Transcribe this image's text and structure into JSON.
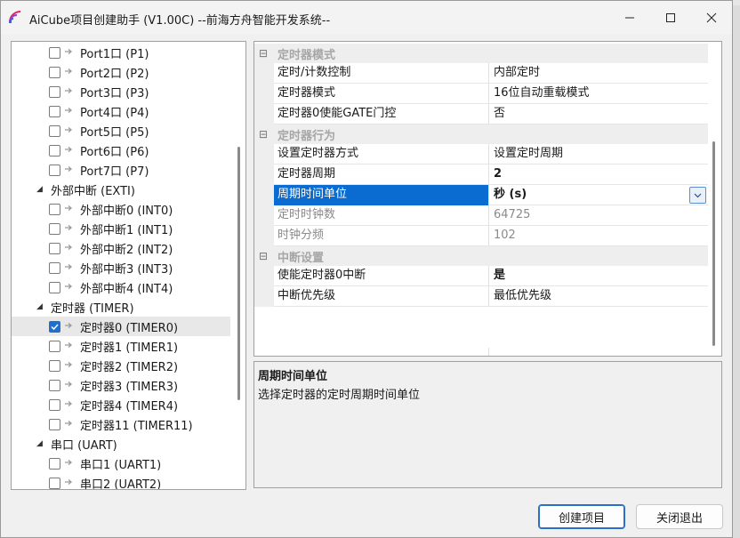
{
  "window": {
    "title": "AiCube项目创建助手 (V1.00C) --前海方舟智能开发系统--"
  },
  "tree": [
    {
      "label": "Port1口 (P1)",
      "level": 2,
      "checkbox": true,
      "checked": false
    },
    {
      "label": "Port2口 (P2)",
      "level": 2,
      "checkbox": true,
      "checked": false
    },
    {
      "label": "Port3口 (P3)",
      "level": 2,
      "checkbox": true,
      "checked": false
    },
    {
      "label": "Port4口 (P4)",
      "level": 2,
      "checkbox": true,
      "checked": false
    },
    {
      "label": "Port5口 (P5)",
      "level": 2,
      "checkbox": true,
      "checked": false
    },
    {
      "label": "Port6口 (P6)",
      "level": 2,
      "checkbox": true,
      "checked": false
    },
    {
      "label": "Port7口 (P7)",
      "level": 2,
      "checkbox": true,
      "checked": false
    },
    {
      "label": "外部中断 (EXTI)",
      "level": 1,
      "checkbox": false,
      "expanded": true
    },
    {
      "label": "外部中断0 (INT0)",
      "level": 2,
      "checkbox": true,
      "checked": false
    },
    {
      "label": "外部中断1 (INT1)",
      "level": 2,
      "checkbox": true,
      "checked": false
    },
    {
      "label": "外部中断2 (INT2)",
      "level": 2,
      "checkbox": true,
      "checked": false
    },
    {
      "label": "外部中断3 (INT3)",
      "level": 2,
      "checkbox": true,
      "checked": false
    },
    {
      "label": "外部中断4 (INT4)",
      "level": 2,
      "checkbox": true,
      "checked": false
    },
    {
      "label": "定时器 (TIMER)",
      "level": 1,
      "checkbox": false,
      "expanded": true
    },
    {
      "label": "定时器0 (TIMER0)",
      "level": 2,
      "checkbox": true,
      "checked": true,
      "selected": true
    },
    {
      "label": "定时器1 (TIMER1)",
      "level": 2,
      "checkbox": true,
      "checked": false
    },
    {
      "label": "定时器2 (TIMER2)",
      "level": 2,
      "checkbox": true,
      "checked": false
    },
    {
      "label": "定时器3 (TIMER3)",
      "level": 2,
      "checkbox": true,
      "checked": false
    },
    {
      "label": "定时器4 (TIMER4)",
      "level": 2,
      "checkbox": true,
      "checked": false
    },
    {
      "label": "定时器11 (TIMER11)",
      "level": 2,
      "checkbox": true,
      "checked": false
    },
    {
      "label": "串口 (UART)",
      "level": 1,
      "checkbox": false,
      "expanded": true
    },
    {
      "label": "串口1 (UART1)",
      "level": 2,
      "checkbox": true,
      "checked": false
    },
    {
      "label": "串口2 (UART2)",
      "level": 2,
      "checkbox": true,
      "checked": false
    }
  ],
  "properties": {
    "categories": [
      {
        "title": "定时器模式",
        "rows": [
          {
            "name": "定时/计数控制",
            "value": "内部定时"
          },
          {
            "name": "定时器模式",
            "value": "16位自动重载模式"
          },
          {
            "name": "定时器0使能GATE门控",
            "value": "否"
          }
        ]
      },
      {
        "title": "定时器行为",
        "rows": [
          {
            "name": "设置定时器方式",
            "value": "设置定时周期"
          },
          {
            "name": "定时器周期",
            "value": "2",
            "bold": true
          },
          {
            "name": "周期时间单位",
            "value": "秒 (s)",
            "bold": true,
            "active": true,
            "dropdown": true
          },
          {
            "name": "定时时钟数",
            "value": "64725",
            "readonly": true
          },
          {
            "name": "时钟分频",
            "value": "102",
            "readonly": true
          }
        ]
      },
      {
        "title": "中断设置",
        "rows": [
          {
            "name": "使能定时器0中断",
            "value": "是",
            "bold": true
          },
          {
            "name": "中断优先级",
            "value": "最低优先级"
          }
        ]
      }
    ]
  },
  "description": {
    "title": "周期时间单位",
    "text": "选择定时器的定时周期时间单位"
  },
  "buttons": {
    "create": "创建项目",
    "close": "关闭退出"
  },
  "colors": {
    "selection": "#0a6bd0",
    "check_accent": "#1f6fd1",
    "primary_button_border": "#2a6fc9"
  }
}
